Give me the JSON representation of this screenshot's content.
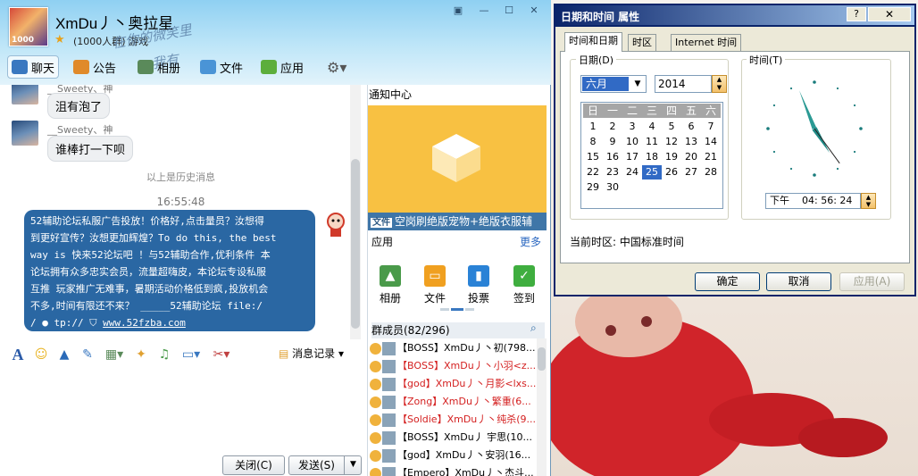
{
  "window": {
    "group_name": "XmDu丿丶奥拉星",
    "group_info": "(1000人群) 游戏",
    "avatar_text": "1000",
    "decor_line1": "在你的微笑里",
    "decor_line2": "我有"
  },
  "tabs": [
    "聊天",
    "公告",
    "相册",
    "文件",
    "应用"
  ],
  "chat": {
    "messages": [
      {
        "sender": "__Sweety、神",
        "text": "沮有泡了"
      },
      {
        "sender": "__Sweety、神",
        "text": "谁棒打一下呗"
      }
    ],
    "history_divider": "以上是历史消息",
    "timestamp": "16:55:48",
    "ad_lines": [
      "52辅助论坛私服广告投放！价格好,点击量员？汝想得",
      "到更好宣传？汝想更加辉煌？To do this, the best",
      "way is 快来52论坛吧 ！与52辅助合作,优利条件 本",
      "论坛拥有众多忠实会员，流量超嗨皮，本论坛专设私服",
      "互推 玩家推广无难事，暑期活动价格低到疯,投放机会",
      "不多,时间有限还不来？  _____52辅助论坛    file:/"
    ],
    "ad_last_prefix": "/",
    "ad_last_mid": "tp://",
    "ad_link": "www.52fzba.com"
  },
  "toolbar": {
    "history": "消息记录"
  },
  "buttons": {
    "close": "关闭(C)",
    "send": "发送(S)"
  },
  "right_panel": {
    "notice_title": "通知中心",
    "ad_tag": "文件",
    "ad_text": "空岗刷绝版宠物+绝版衣服辅",
    "apps_title": "应用",
    "apps_more": "更多",
    "apps": [
      "相册",
      "文件",
      "投票",
      "签到"
    ],
    "members_title": "群成员(82/296)",
    "members": [
      {
        "name": "【BOSS】XmDu丿丶初(798...",
        "red": false
      },
      {
        "name": "【BOSS】XmDu丿丶小羽<z...",
        "red": true
      },
      {
        "name": "【god】XmDu丿丶月影<lxs...",
        "red": true
      },
      {
        "name": "【Zong】XmDu丿丶繁重(6...",
        "red": true
      },
      {
        "name": "【Soldie】XmDu丿丶纯杀(9...",
        "red": true
      },
      {
        "name": "【BOSS】XmDu丿  宇思(10...",
        "red": false
      },
      {
        "name": "【god】XmDu丿丶安羽(16...",
        "red": false
      },
      {
        "name": "【Empero】XmDu丿丶杰斗...",
        "red": false
      }
    ]
  },
  "dialog": {
    "title": "日期和时间 属性",
    "help": "?",
    "close": "✕",
    "tabs": [
      "时间和日期",
      "时区",
      "Internet 时间"
    ],
    "date_group": "日期(D)",
    "time_group": "时间(T)",
    "month": "六月",
    "year": "2014",
    "weekdays": [
      "日",
      "一",
      "二",
      "三",
      "四",
      "五",
      "六"
    ],
    "days": [
      "1",
      "2",
      "3",
      "4",
      "5",
      "6",
      "7",
      "8",
      "9",
      "10",
      "11",
      "12",
      "13",
      "14",
      "15",
      "16",
      "17",
      "18",
      "19",
      "20",
      "21",
      "22",
      "23",
      "24",
      "25",
      "26",
      "27",
      "28",
      "29",
      "30"
    ],
    "selected_day": "25",
    "time_ampm": "下午",
    "time_value": "04: 56: 24",
    "timezone_label": "当前时区: 中国标准时间",
    "btn_ok": "确定",
    "btn_cancel": "取消",
    "btn_apply": "应用(A)"
  },
  "colors": {
    "title_bar": "#0a246a",
    "chat_ad_bubble": "#2a67a3",
    "notice_bg": "#f8c142",
    "member_red": "#d42020",
    "selected_day": "#316ac5"
  }
}
